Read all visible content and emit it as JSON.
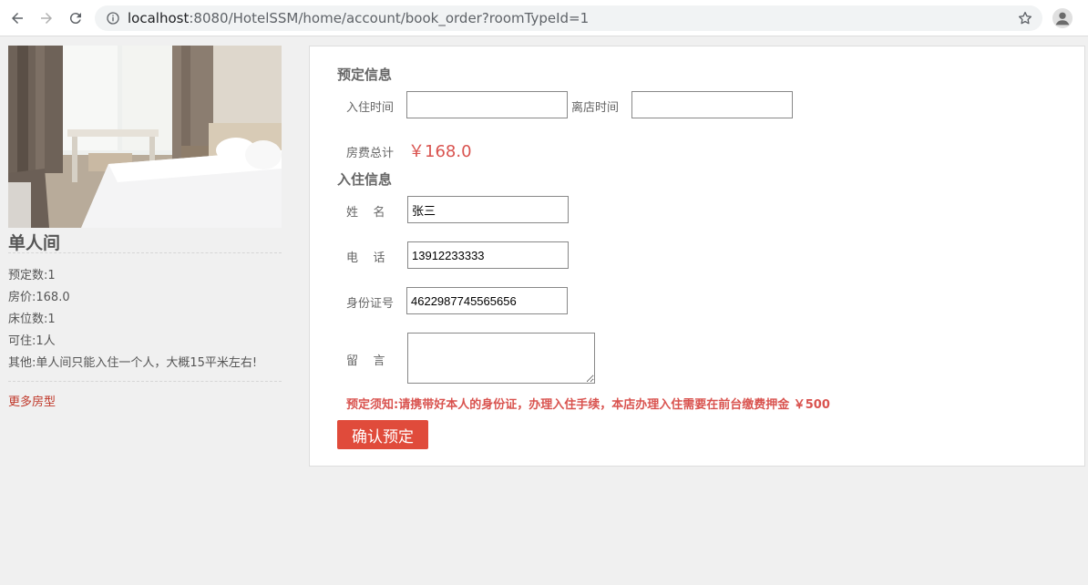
{
  "browser": {
    "url_host": "localhost",
    "url_port_path": ":8080/HotelSSM/home/account/book_order?roomTypeId=1"
  },
  "room": {
    "name": "单人间",
    "details": [
      "预定数:1",
      "房价:168.0",
      "床位数:1",
      "可住:1人",
      "其他:单人间只能入住一个人，大概15平米左右!"
    ],
    "more_link": "更多房型"
  },
  "form": {
    "booking_section": "预定信息",
    "checkin_label": "入住时间",
    "checkin_value": "",
    "checkout_label": "离店时间",
    "checkout_value": "",
    "total_label": "房费总计",
    "total_value": "￥168.0",
    "guest_section": "入住信息",
    "name_label": "姓    名",
    "name_value": "张三",
    "phone_label": "电    话",
    "phone_value": "13912233333",
    "id_label": "身份证号",
    "id_value": "4622987745565656",
    "message_label": "留    言",
    "message_value": "",
    "notice": "预定须知:请携带好本人的身份证，办理入住手续，本店办理入住需要在前台缴费押金 ￥500",
    "submit_label": "确认预定"
  },
  "colors": {
    "accent_red": "#e04b3b",
    "price_red": "#d9534f"
  },
  "icons": [
    "back-arrow-icon",
    "forward-arrow-icon",
    "reload-icon",
    "info-icon",
    "star-icon",
    "profile-icon"
  ]
}
